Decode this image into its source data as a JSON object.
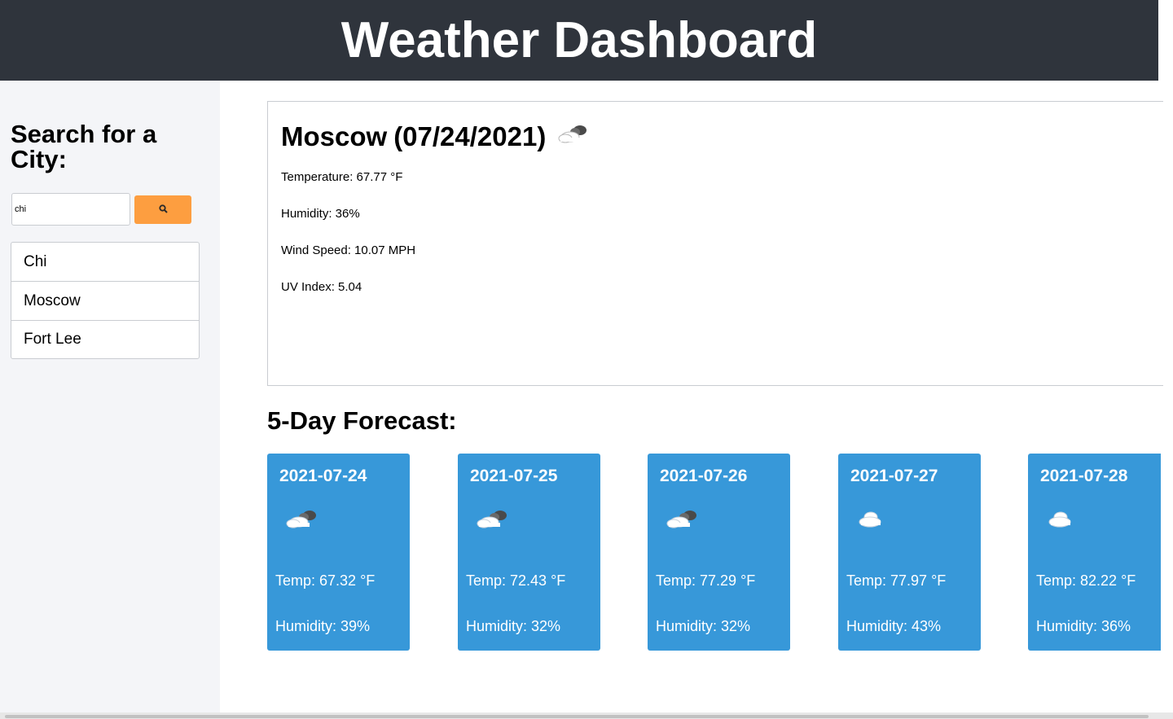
{
  "header": {
    "title": "Weather Dashboard"
  },
  "sidebar": {
    "heading": "Search for a City:",
    "search": {
      "value": "chi"
    },
    "search_button_icon": "search-icon",
    "history": [
      {
        "label": "Chi"
      },
      {
        "label": "Moscow"
      },
      {
        "label": "Fort Lee"
      }
    ]
  },
  "current": {
    "city": "Moscow",
    "date": "(07/24/2021)",
    "icon": "partly-cloudy-icon",
    "temperature": "Temperature: 67.77 °F",
    "humidity": "Humidity: 36%",
    "wind": "Wind Speed: 10.07 MPH",
    "uv": "UV Index: 5.04"
  },
  "forecast": {
    "title": "5-Day Forecast:",
    "days": [
      {
        "date": "2021-07-24",
        "icon": "partly-cloudy-icon",
        "temp": "Temp: 67.32 °F",
        "humidity": "Humidity: 39%"
      },
      {
        "date": "2021-07-25",
        "icon": "partly-cloudy-icon",
        "temp": "Temp: 72.43 °F",
        "humidity": "Humidity: 32%"
      },
      {
        "date": "2021-07-26",
        "icon": "partly-cloudy-icon",
        "temp": "Temp: 77.29 °F",
        "humidity": "Humidity: 32%"
      },
      {
        "date": "2021-07-27",
        "icon": "cloud-icon",
        "temp": "Temp: 77.97 °F",
        "humidity": "Humidity: 43%"
      },
      {
        "date": "2021-07-28",
        "icon": "cloud-icon",
        "temp": "Temp: 82.22 °F",
        "humidity": "Humidity: 36%"
      }
    ]
  },
  "colors": {
    "header_bg": "#2f343c",
    "sidebar_bg": "#f4f5f8",
    "search_button": "#fd9e40",
    "card_bg": "#3798d9"
  }
}
